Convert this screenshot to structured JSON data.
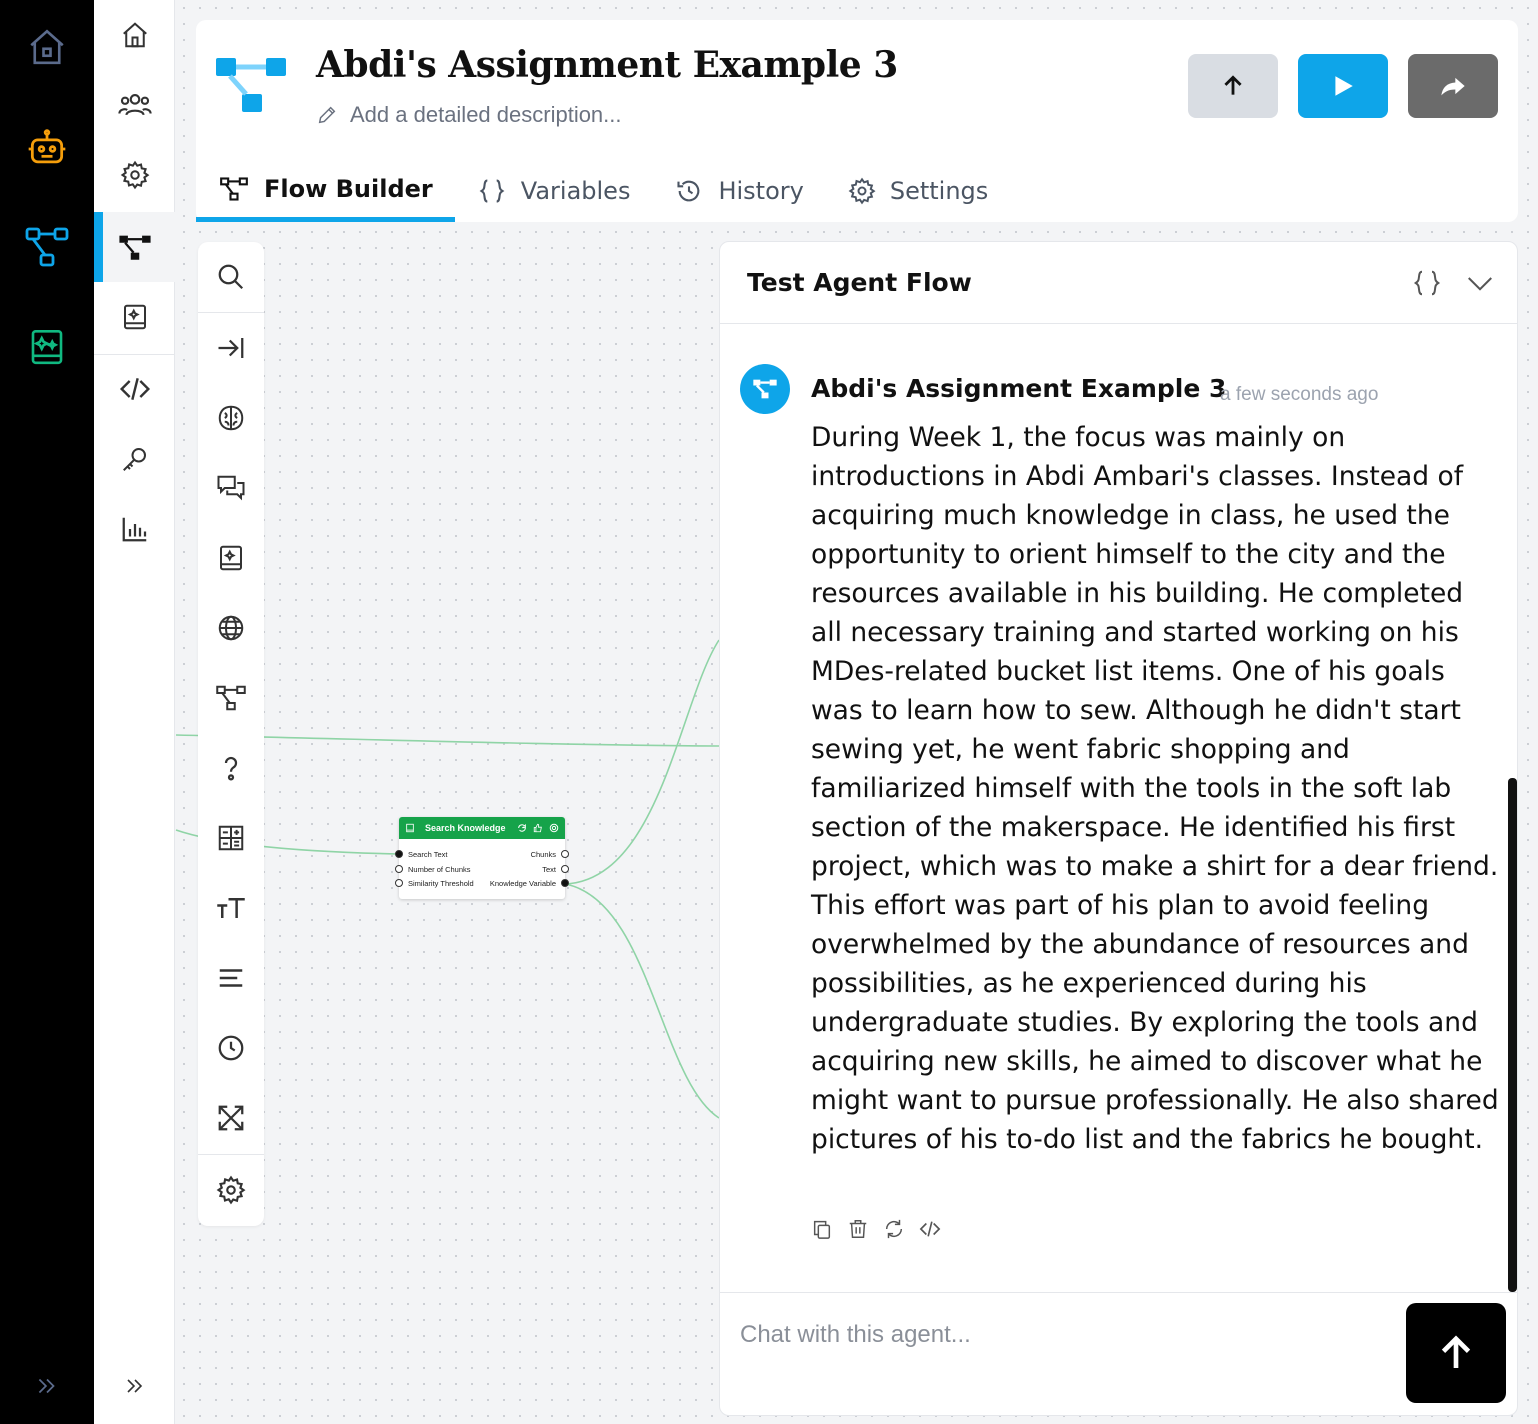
{
  "app": {
    "flow_title": "Abdi's Assignment Example 3",
    "description_placeholder": "Add a detailed description...",
    "accent_color": "#0ea5e9"
  },
  "rail": {
    "items": [
      {
        "icon": "home-icon",
        "color": "#5b6b8c"
      },
      {
        "icon": "robot-icon",
        "color": "#f59e0b"
      },
      {
        "icon": "flow-icon",
        "color": "#0ea5e9"
      },
      {
        "icon": "knowledge-book-icon",
        "color": "#10b981"
      }
    ],
    "expand_icon": "double-chevron-right-icon"
  },
  "sidebar": {
    "items": [
      {
        "icon": "home-icon"
      },
      {
        "icon": "users-icon"
      },
      {
        "icon": "gear-icon"
      },
      {
        "icon": "flow-icon",
        "active": true
      },
      {
        "icon": "knowledge-book-icon"
      },
      {
        "icon": "code-icon"
      },
      {
        "icon": "key-icon"
      },
      {
        "icon": "bar-chart-icon"
      }
    ]
  },
  "header": {
    "buttons": [
      {
        "icon": "arrow-up-icon",
        "color": "#d9dde3"
      },
      {
        "icon": "play-icon",
        "color": "#0ea5e9"
      },
      {
        "icon": "share-icon",
        "color": "#6b6b6b"
      }
    ],
    "tabs": [
      {
        "label": "Flow Builder",
        "icon": "flow-icon",
        "active": true
      },
      {
        "label": "Variables",
        "icon": "braces-icon"
      },
      {
        "label": "History",
        "icon": "history-icon"
      },
      {
        "label": "Settings",
        "icon": "gear-icon"
      }
    ]
  },
  "toolbar": {
    "tools": [
      "search-icon",
      "input-icon",
      "brain-icon",
      "chat-icon",
      "knowledge-book-icon",
      "globe-icon",
      "flow-icon",
      "question-icon",
      "calculator-icon",
      "text-size-icon",
      "text-lines-icon",
      "clock-icon",
      "expand-arrows-icon",
      "gear-icon"
    ]
  },
  "node": {
    "title": "Search Knowledge",
    "color": "#16a34a",
    "inputs": [
      "Search Text",
      "Number of Chunks",
      "Similarity Threshold"
    ],
    "outputs": [
      "Chunks",
      "Text",
      "Knowledge Variable"
    ]
  },
  "test_panel": {
    "title": "Test Agent Flow",
    "message": {
      "author": "Abdi's Assignment Example 3",
      "time": "a few seconds ago",
      "text": "During Week 1, the focus was mainly on introductions in Abdi Ambari's classes. Instead of acquiring much knowledge in class, he used the opportunity to orient himself to the city and the resources available in his building. He completed all necessary training and started working on his MDes-related bucket list items. One of his goals was to learn how to sew. Although he didn't start sewing yet, he went fabric shopping and familiarized himself with the tools in the soft lab section of the makerspace. He identified his first project, which was to make a shirt for a dear friend. This effort was part of his plan to avoid feeling overwhelmed by the abundance of resources and possibilities, as he experienced during his undergraduate studies. By exploring the tools and acquiring new skills, he aimed to discover what he might want to pursue professionally. He also shared pictures of his to-do list and the fabrics he bought.",
      "actions": [
        "copy-icon",
        "trash-icon",
        "refresh-icon",
        "code-icon"
      ]
    },
    "chat_placeholder": "Chat with this agent...",
    "send_icon": "arrow-up-icon"
  }
}
